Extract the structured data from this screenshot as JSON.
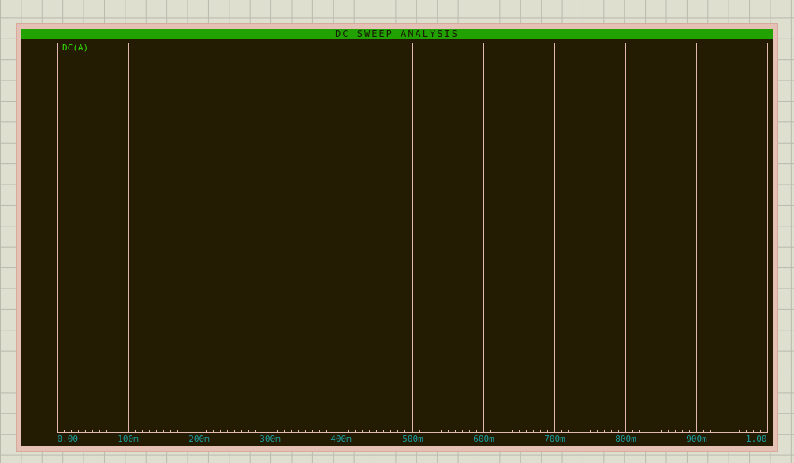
{
  "chart_data": {
    "type": "line",
    "title": "DC SWEEP ANALYSIS",
    "series": [
      {
        "name": "DC(A)",
        "values": []
      }
    ],
    "x_ticks": [
      "0.00",
      "100m",
      "200m",
      "300m",
      "400m",
      "500m",
      "600m",
      "700m",
      "800m",
      "900m",
      "1.00"
    ],
    "xlim": [
      0,
      1
    ],
    "minor_ticks_per_major": 9,
    "grid": true,
    "colors": {
      "title_bar": "#22a200",
      "background": "#241c02",
      "grid": "#e0b8b0",
      "tick_label": "#1aa0a0",
      "legend": "#33dd00"
    }
  }
}
